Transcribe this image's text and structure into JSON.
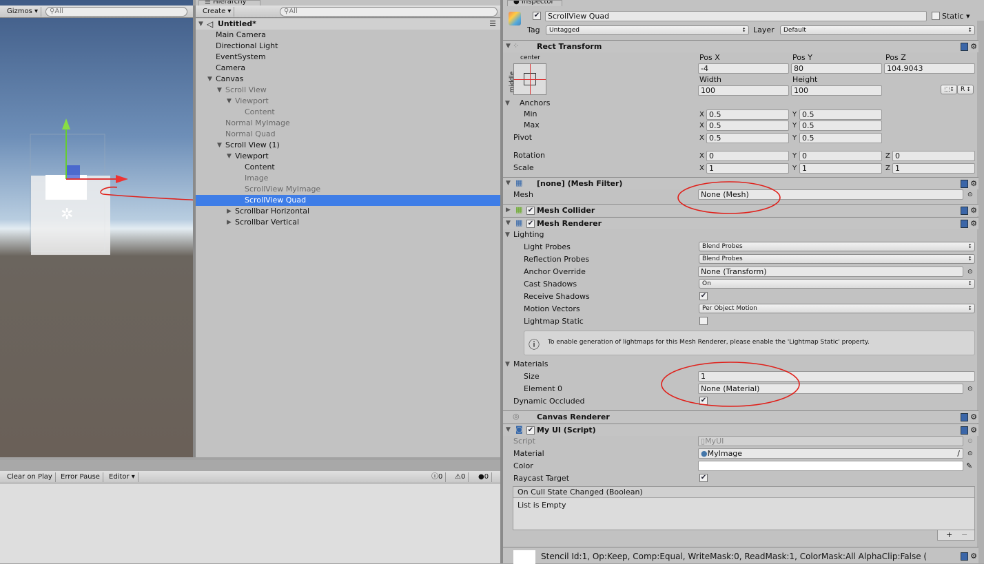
{
  "scene": {
    "gizmos_label": "Gizmos",
    "search_placeholder": "All"
  },
  "hierarchy": {
    "tab": "Hierarchy",
    "create_label": "Create",
    "search_placeholder": "All",
    "scene_name": "Untitled*",
    "items": [
      {
        "label": "Main Camera",
        "depth": 0,
        "arrow": "",
        "state": "normal"
      },
      {
        "label": "Directional Light",
        "depth": 0,
        "arrow": "",
        "state": "normal"
      },
      {
        "label": "EventSystem",
        "depth": 0,
        "arrow": "",
        "state": "normal"
      },
      {
        "label": "Camera",
        "depth": 0,
        "arrow": "",
        "state": "normal"
      },
      {
        "label": "Canvas",
        "depth": 0,
        "arrow": "expanded",
        "state": "normal"
      },
      {
        "label": "Scroll View",
        "depth": 1,
        "arrow": "expanded",
        "state": "inactive"
      },
      {
        "label": "Viewport",
        "depth": 2,
        "arrow": "expanded",
        "state": "inactive"
      },
      {
        "label": "Content",
        "depth": 3,
        "arrow": "",
        "state": "inactive"
      },
      {
        "label": "Normal MyImage",
        "depth": 1,
        "arrow": "",
        "state": "inactive"
      },
      {
        "label": "Normal Quad",
        "depth": 1,
        "arrow": "",
        "state": "inactive"
      },
      {
        "label": "Scroll View (1)",
        "depth": 1,
        "arrow": "expanded",
        "state": "normal"
      },
      {
        "label": "Viewport",
        "depth": 2,
        "arrow": "expanded",
        "state": "normal"
      },
      {
        "label": "Content",
        "depth": 3,
        "arrow": "",
        "state": "normal"
      },
      {
        "label": "Image",
        "depth": 3,
        "arrow": "",
        "state": "inactive"
      },
      {
        "label": "ScrollView MyImage",
        "depth": 3,
        "arrow": "",
        "state": "inactive"
      },
      {
        "label": "ScrollView Quad",
        "depth": 3,
        "arrow": "",
        "state": "selected"
      },
      {
        "label": "Scrollbar Horizontal",
        "depth": 2,
        "arrow": "collapsed",
        "state": "normal"
      },
      {
        "label": "Scrollbar Vertical",
        "depth": 2,
        "arrow": "collapsed",
        "state": "normal"
      }
    ]
  },
  "console": {
    "clear_on_play": "Clear on Play",
    "error_pause": "Error Pause",
    "editor": "Editor",
    "info_count": "0",
    "warn_count": "0",
    "error_count": "0"
  },
  "inspector": {
    "tab": "Inspector",
    "object_name": "ScrollView Quad",
    "active": true,
    "static_label": "Static",
    "tag_label": "Tag",
    "tag_value": "Untagged",
    "layer_label": "Layer",
    "layer_value": "Default",
    "rect": {
      "title": "Rect Transform",
      "anchor_h": "center",
      "anchor_v": "middle",
      "pos_x_label": "Pos X",
      "pos_y_label": "Pos Y",
      "pos_z_label": "Pos Z",
      "pos_x": "-4",
      "pos_y": "80",
      "pos_z": "104.9043",
      "width_label": "Width",
      "height_label": "Height",
      "width": "100",
      "height": "100",
      "raw_btn": "R",
      "anchors_label": "Anchors",
      "min_label": "Min",
      "max_label": "Max",
      "pivot_label": "Pivot",
      "min_x": "0.5",
      "min_y": "0.5",
      "max_x": "0.5",
      "max_y": "0.5",
      "pivot_x": "0.5",
      "pivot_y": "0.5",
      "rotation_label": "Rotation",
      "rot_x": "0",
      "rot_y": "0",
      "rot_z": "0",
      "scale_label": "Scale",
      "scale_x": "1",
      "scale_y": "1",
      "scale_z": "1",
      "x": "X",
      "y": "Y",
      "z": "Z"
    },
    "mesh_filter": {
      "title": "[none] (Mesh Filter)",
      "mesh_label": "Mesh",
      "mesh_value": "None (Mesh)"
    },
    "mesh_collider": {
      "title": "Mesh Collider"
    },
    "mesh_renderer": {
      "title": "Mesh Renderer",
      "lighting": "Lighting",
      "light_probes_label": "Light Probes",
      "light_probes": "Blend Probes",
      "reflection_label": "Reflection Probes",
      "reflection": "Blend Probes",
      "anchor_label": "Anchor Override",
      "anchor": "None (Transform)",
      "cast_label": "Cast Shadows",
      "cast": "On",
      "receive_label": "Receive Shadows",
      "receive": true,
      "motion_label": "Motion Vectors",
      "motion": "Per Object Motion",
      "lightmap_label": "Lightmap Static",
      "lightmap": false,
      "help": "To enable generation of lightmaps for this Mesh Renderer, please enable the 'Lightmap Static' property.",
      "materials_label": "Materials",
      "size_label": "Size",
      "size": "1",
      "element0_label": "Element 0",
      "element0": "None (Material)",
      "dynamic_label": "Dynamic Occluded",
      "dynamic": true
    },
    "canvas_renderer": {
      "title": "Canvas Renderer"
    },
    "my_ui": {
      "title": "My UI (Script)",
      "script_label": "Script",
      "script": "MyUI",
      "material_label": "Material",
      "material": "MyImage",
      "color_label": "Color",
      "color": "#ffffff",
      "raycast_label": "Raycast Target",
      "raycast": true,
      "event_title": "On Cull State Changed (Boolean)",
      "event_empty": "List is Empty",
      "add": "+",
      "remove": "−"
    },
    "material_preview": {
      "stencil": "Stencil Id:1, Op:Keep, Comp:Equal, WriteMask:0, ReadMask:1, ColorMask:All AlphaClip:False ("
    }
  },
  "colors": {
    "selection": "#3e7de7",
    "annotation": "#e0201a"
  }
}
